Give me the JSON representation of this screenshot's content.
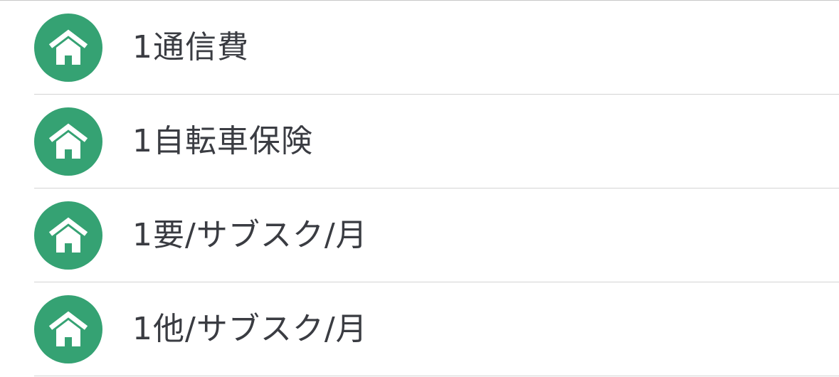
{
  "colors": {
    "icon_background": "#35a273",
    "icon_foreground": "#ffffff",
    "text": "#3a3c42",
    "divider": "#d4d4d4"
  },
  "list": {
    "items": [
      {
        "label": "1通信費",
        "icon": "home-icon"
      },
      {
        "label": "1自転車保険",
        "icon": "home-icon"
      },
      {
        "label": "1要/サブスク/月",
        "icon": "home-icon"
      },
      {
        "label": "1他/サブスク/月",
        "icon": "home-icon"
      }
    ]
  }
}
